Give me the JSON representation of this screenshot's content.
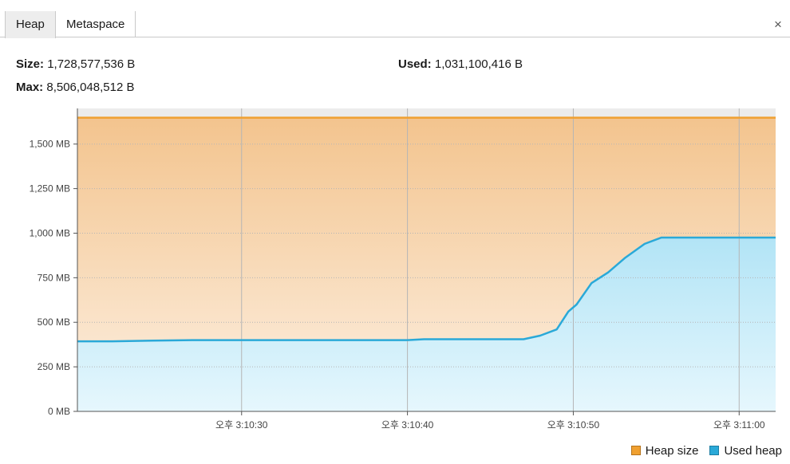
{
  "tabs": [
    {
      "label": "Heap",
      "active": true
    },
    {
      "label": "Metaspace",
      "active": false
    }
  ],
  "close_label": "×",
  "stats": {
    "size_label": "Size:",
    "size_value": "1,728,577,536 B",
    "used_label": "Used:",
    "used_value": "1,031,100,416 B",
    "max_label": "Max:",
    "max_value": "8,506,048,512 B"
  },
  "colors": {
    "heap_size": "#f0a030",
    "used_heap": "#2aa9d8"
  },
  "chart_data": {
    "type": "area",
    "yticks": [
      {
        "value": 0,
        "label": "0 MB"
      },
      {
        "value": 250,
        "label": "250 MB"
      },
      {
        "value": 500,
        "label": "500 MB"
      },
      {
        "value": 750,
        "label": "750 MB"
      },
      {
        "value": 1000,
        "label": "1,000 MB"
      },
      {
        "value": 1250,
        "label": "1,250 MB"
      },
      {
        "value": 1500,
        "label": "1,500 MB"
      }
    ],
    "xticks": [
      {
        "value": 30,
        "label": "오후 3:10:30"
      },
      {
        "value": 40,
        "label": "오후 3:10:40"
      },
      {
        "value": 50,
        "label": "오후 3:10:50"
      },
      {
        "value": 60,
        "label": "오후 3:11:00"
      }
    ],
    "xlim": [
      20.1,
      62.2
    ],
    "ylim": [
      0,
      1700
    ],
    "grid": true,
    "legend_position": "bottom-right",
    "series": [
      {
        "name": "Heap size",
        "x": [
          20.1,
          62.2
        ],
        "y": [
          1648,
          1648
        ]
      },
      {
        "name": "Used heap",
        "x": [
          20.1,
          22.2,
          24.6,
          27.0,
          40.0,
          41.0,
          47.0,
          48.0,
          49.0,
          49.7,
          50.2,
          51.1,
          52.1,
          53.1,
          54.3,
          55.3,
          57.5,
          60.0,
          62.2
        ],
        "y": [
          393,
          393,
          397,
          400,
          400,
          405,
          405,
          425,
          460,
          560,
          600,
          720,
          780,
          860,
          940,
          975,
          975,
          975,
          975
        ]
      }
    ]
  },
  "legend": [
    {
      "label": "Heap size"
    },
    {
      "label": "Used heap"
    }
  ]
}
